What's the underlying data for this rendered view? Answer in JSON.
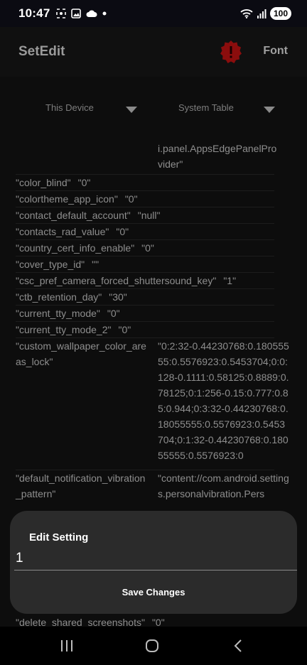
{
  "status_bar": {
    "time": "10:47",
    "battery": "100"
  },
  "app_bar": {
    "title": "SetEdit",
    "font_label": "Font"
  },
  "filters": {
    "scope": "This Device",
    "table": "System Table"
  },
  "settings": [
    {
      "key": "",
      "value": "i.panel.AppsEdgePanelProvider\""
    },
    {
      "key": "\"color_blind\"",
      "value": "\"0\""
    },
    {
      "key": "\"colortheme_app_icon\"",
      "value": "\"0\""
    },
    {
      "key": "\"contact_default_account\"",
      "value": "\"null\""
    },
    {
      "key": "\"contacts_rad_value\"",
      "value": "\"0\""
    },
    {
      "key": "\"country_cert_info_enable\"",
      "value": "\"0\""
    },
    {
      "key": "\"cover_type_id\"",
      "value": "\"\""
    },
    {
      "key": "\"csc_pref_camera_forced_shuttersound_key\"",
      "value": "\"1\""
    },
    {
      "key": "\"ctb_retention_day\"",
      "value": "\"30\""
    },
    {
      "key": "\"current_tty_mode\"",
      "value": "\"0\""
    },
    {
      "key": "\"current_tty_mode_2\"",
      "value": "\"0\""
    },
    {
      "key": "\"custom_wallpaper_color_areas_lock\"",
      "value": "\"0:2:32-0.44230768:0.18055555:0.5576923:0.5453704;0:0:128-0.1111:0.58125:0.8889:0.78125;0:1:256-0.15:0.777:0.85:0.944;0:3:32-0.44230768:0.18055555:0.5576923:0.5453704;0:1:32-0.44230768:0.18055555:0.5576923:0"
    },
    {
      "key": "\"default_notification_vibration_pattern\"",
      "value": "\"content://com.android.settings.personalvibration.Pers"
    }
  ],
  "partial_row": {
    "key": "\"delete_shared_screenshots\"",
    "value": "\"0\""
  },
  "edit_dialog": {
    "title": "Edit Setting",
    "value": "1",
    "save_label": "Save Changes"
  }
}
